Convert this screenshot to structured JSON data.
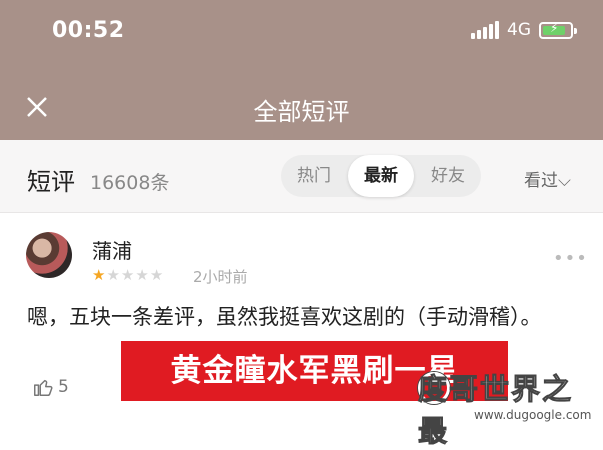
{
  "status_bar": {
    "time": "00:52",
    "network": "4G"
  },
  "header": {
    "title": "全部短评",
    "close_icon": "close-icon"
  },
  "sub_header": {
    "title": "短评",
    "count": "16608条",
    "tabs": [
      {
        "label": "热门",
        "active": false
      },
      {
        "label": "最新",
        "active": true
      },
      {
        "label": "好友",
        "active": false
      }
    ],
    "filter": "看过"
  },
  "review": {
    "username": "蒲浦",
    "rating": 1,
    "rating_max": 5,
    "time": "2小时前",
    "content": "嗯，五块一条差评，虽然我挺喜欢这剧的（手动滑稽）。",
    "likes": "5"
  },
  "overlay": {
    "banner": "黄金瞳水军黑刷一星",
    "watermark": "度哥世界之最",
    "watermark_url": "www.dugoogle.com"
  },
  "colors": {
    "header_bg": "#a89189",
    "star": "#f5a623",
    "banner_bg": "#e01b22"
  }
}
